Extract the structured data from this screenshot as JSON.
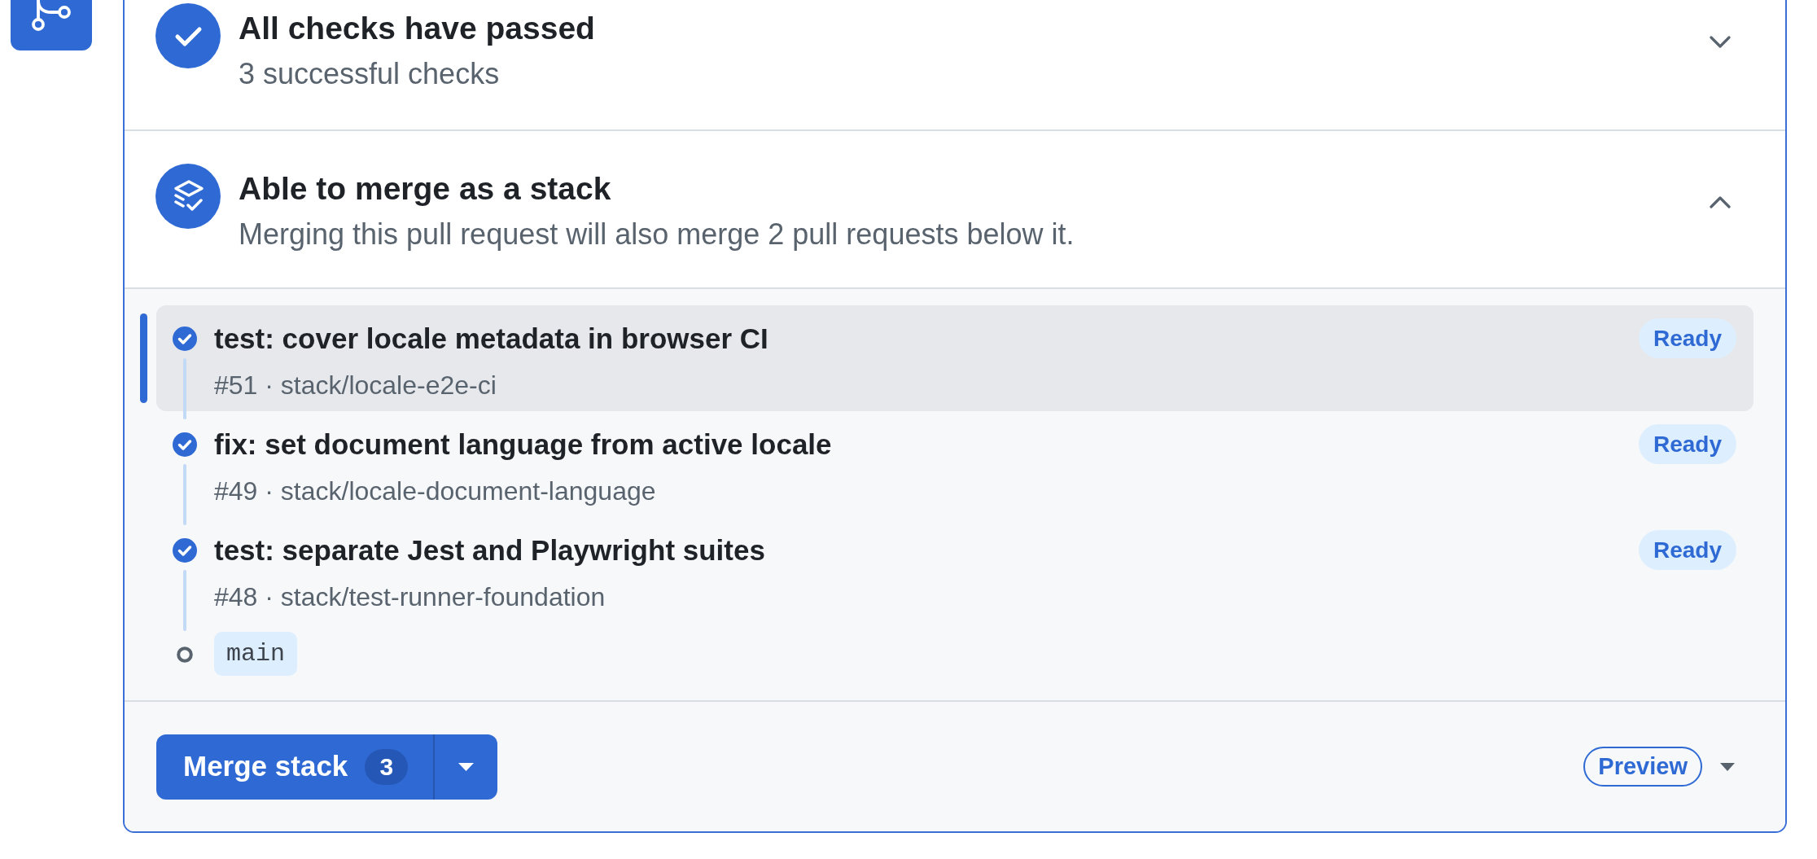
{
  "sections": [
    {
      "kind": "checks",
      "title": "All checks have passed",
      "subtitle": "3 successful checks",
      "expanded": false
    },
    {
      "kind": "stack",
      "title": "Able to merge as a stack",
      "subtitle": "Merging this pull request will also merge 2 pull requests below it.",
      "expanded": true,
      "stack": [
        {
          "title": "test: cover locale metadata in browser CI",
          "meta": "#51 · stack/locale-e2e-ci",
          "status": "Ready",
          "selected": true
        },
        {
          "title": "fix: set document language from active locale",
          "meta": "#49 · stack/locale-document-language",
          "status": "Ready",
          "selected": false
        },
        {
          "title": "test: separate Jest and Playwright suites",
          "meta": "#48 · stack/test-runner-foundation",
          "status": "Ready",
          "selected": false
        }
      ],
      "base_branch": "main"
    }
  ],
  "footer": {
    "merge_button": {
      "label": "Merge stack",
      "count": "3"
    },
    "preview_label": "Preview"
  }
}
